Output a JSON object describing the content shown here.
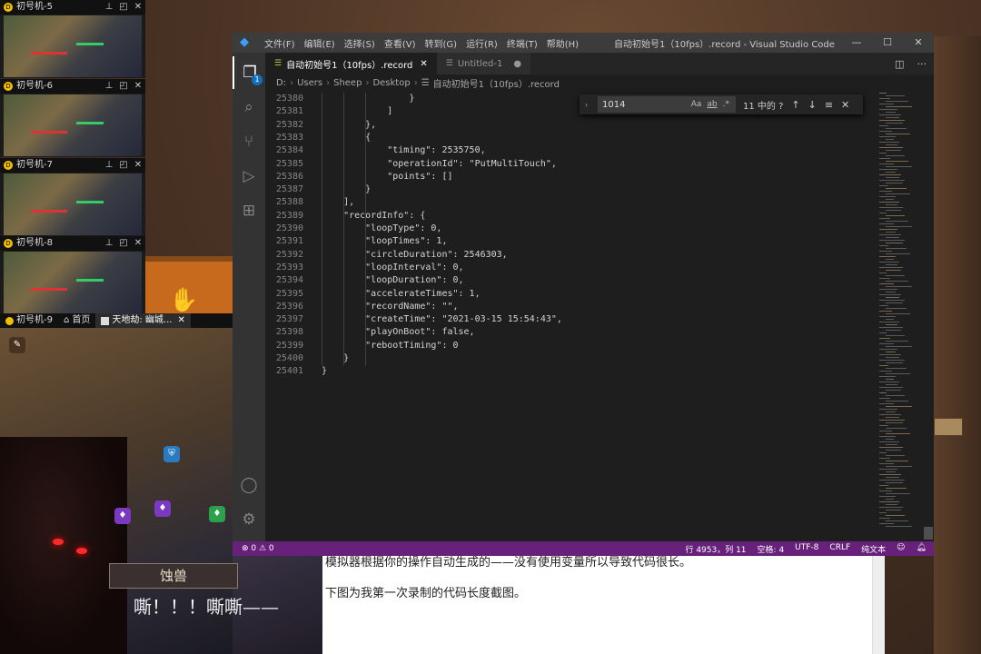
{
  "emulators": [
    {
      "title": "初号机-5"
    },
    {
      "title": "初号机-6"
    },
    {
      "title": "初号机-7"
    },
    {
      "title": "初号机-8"
    }
  ],
  "emu9": {
    "title": "初号机-9",
    "tab_home": "首页",
    "tab_game": "天地劫: 幽城..."
  },
  "game": {
    "speaker": "蚀兽",
    "line": "嘶！！！嘶嘶——"
  },
  "vscode": {
    "menu": [
      "文件(F)",
      "编辑(E)",
      "选择(S)",
      "查看(V)",
      "转到(G)",
      "运行(R)",
      "终端(T)",
      "帮助(H)"
    ],
    "window_title": "自动初始号1（10fps）.record - Visual Studio Code",
    "tabs": [
      {
        "label": "自动初始号1（10fps）.record",
        "active": true
      },
      {
        "label": "Untitled-1",
        "active": false
      }
    ],
    "explorer_badge": "1",
    "breadcrumb": [
      "D:",
      "Users",
      "Sheep",
      "Desktop",
      "自动初始号1（10fps）.record"
    ],
    "find": {
      "value": "1014",
      "case_opt": "Aa",
      "word_opt": "ab",
      "regex_opt": ".*",
      "result": "11 中的 ?"
    },
    "status": {
      "problems": "⊗ 0 ⚠ 0",
      "position": "行 4953，列 11",
      "spaces": "空格: 4",
      "encoding": "UTF-8",
      "eol": "CRLF",
      "language": "纯文本"
    },
    "code": [
      {
        "ln": "25380",
        "text": "                }"
      },
      {
        "ln": "25381",
        "text": "            ]"
      },
      {
        "ln": "25382",
        "text": "        },"
      },
      {
        "ln": "25383",
        "text": "        {"
      },
      {
        "ln": "25384",
        "text": "            \"timing\": 2535750,"
      },
      {
        "ln": "25385",
        "text": "            \"operationId\": \"PutMultiTouch\","
      },
      {
        "ln": "25386",
        "text": "            \"points\": []"
      },
      {
        "ln": "25387",
        "text": "        }"
      },
      {
        "ln": "25388",
        "text": "    ],"
      },
      {
        "ln": "25389",
        "text": "    \"recordInfo\": {"
      },
      {
        "ln": "25390",
        "text": "        \"loopType\": 0,"
      },
      {
        "ln": "25391",
        "text": "        \"loopTimes\": 1,"
      },
      {
        "ln": "25392",
        "text": "        \"circleDuration\": 2546303,"
      },
      {
        "ln": "25393",
        "text": "        \"loopInterval\": 0,"
      },
      {
        "ln": "25394",
        "text": "        \"loopDuration\": 0,"
      },
      {
        "ln": "25395",
        "text": "        \"accelerateTimes\": 1,"
      },
      {
        "ln": "25396",
        "text": "        \"recordName\": \"\","
      },
      {
        "ln": "25397",
        "text": "        \"createTime\": \"2021-03-15 15:54:43\","
      },
      {
        "ln": "25398",
        "text": "        \"playOnBoot\": false,"
      },
      {
        "ln": "25399",
        "text": "        \"rebootTiming\": 0"
      },
      {
        "ln": "25400",
        "text": "    }"
      },
      {
        "ln": "25401",
        "text": "}"
      }
    ]
  },
  "article": {
    "line1": "模拟器根据你的操作自动生成的——没有使用变量所以导致代码很长。",
    "line2": "下图为我第一次录制的代码长度截图。"
  },
  "colors": {
    "statusbar": "#68217a",
    "editor_bg": "#1e1e1e",
    "accent": "#0e70c0"
  }
}
